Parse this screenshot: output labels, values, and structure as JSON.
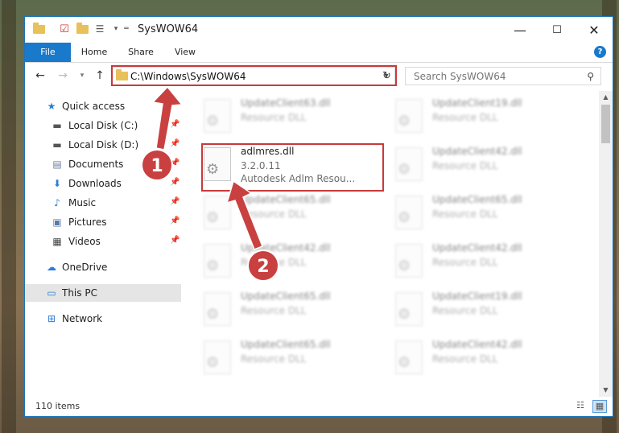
{
  "window": {
    "title": "SysWOW64",
    "controls": {
      "minimize": "—",
      "maximize": "☐",
      "close": "✕"
    }
  },
  "ribbon": {
    "tabs": [
      "File",
      "Home",
      "Share",
      "View"
    ],
    "help": "?"
  },
  "address_bar": {
    "path": "C:\\Windows\\SysWOW64"
  },
  "search": {
    "placeholder": "Search SysWOW64"
  },
  "nav_pane": {
    "items": [
      {
        "label": "Quick access",
        "icon": "star-icon"
      },
      {
        "label": "Local Disk (C:)",
        "icon": "drive-icon",
        "pinned": true
      },
      {
        "label": "Local Disk (D:)",
        "icon": "drive-icon",
        "pinned": true
      },
      {
        "label": "Documents",
        "icon": "documents-icon",
        "pinned": true
      },
      {
        "label": "Downloads",
        "icon": "downloads-icon",
        "pinned": true
      },
      {
        "label": "Music",
        "icon": "music-icon",
        "pinned": true
      },
      {
        "label": "Pictures",
        "icon": "pictures-icon",
        "pinned": true
      },
      {
        "label": "Videos",
        "icon": "videos-icon",
        "pinned": true
      },
      {
        "label": "OneDrive",
        "icon": "cloud-icon"
      },
      {
        "label": "This PC",
        "icon": "computer-icon",
        "selected": true
      },
      {
        "label": "Network",
        "icon": "network-icon"
      }
    ]
  },
  "files": {
    "left": [
      {
        "name": "UpdateClient63.dll",
        "type": "Resource DLL"
      },
      {
        "name": "adlmres.dll",
        "version": "3.2.0.11",
        "desc": "Autodesk Adlm Resou..."
      },
      {
        "name": "UpdateClient65.dll",
        "type": "Resource DLL"
      },
      {
        "name": "UpdateClient42.dll",
        "type": "Resource DLL"
      },
      {
        "name": "UpdateClient65.dll",
        "type": "Resource DLL"
      },
      {
        "name": "UpdateClient65.dll",
        "type": "Resource DLL"
      }
    ],
    "right": [
      {
        "name": "UpdateClient19.dll",
        "type": "Resource DLL"
      },
      {
        "name": "UpdateClient42.dll",
        "type": "Resource DLL"
      },
      {
        "name": "UpdateClient65.dll",
        "type": "Resource DLL"
      },
      {
        "name": "UpdateClient42.dll",
        "type": "Resource DLL"
      },
      {
        "name": "UpdateClient19.dll",
        "type": "Resource DLL"
      },
      {
        "name": "UpdateClient42.dll",
        "type": "Resource DLL"
      }
    ]
  },
  "status_bar": {
    "item_count": "110 items"
  },
  "annotations": {
    "badge1": "1",
    "badge2": "2",
    "color": "#c94040"
  }
}
